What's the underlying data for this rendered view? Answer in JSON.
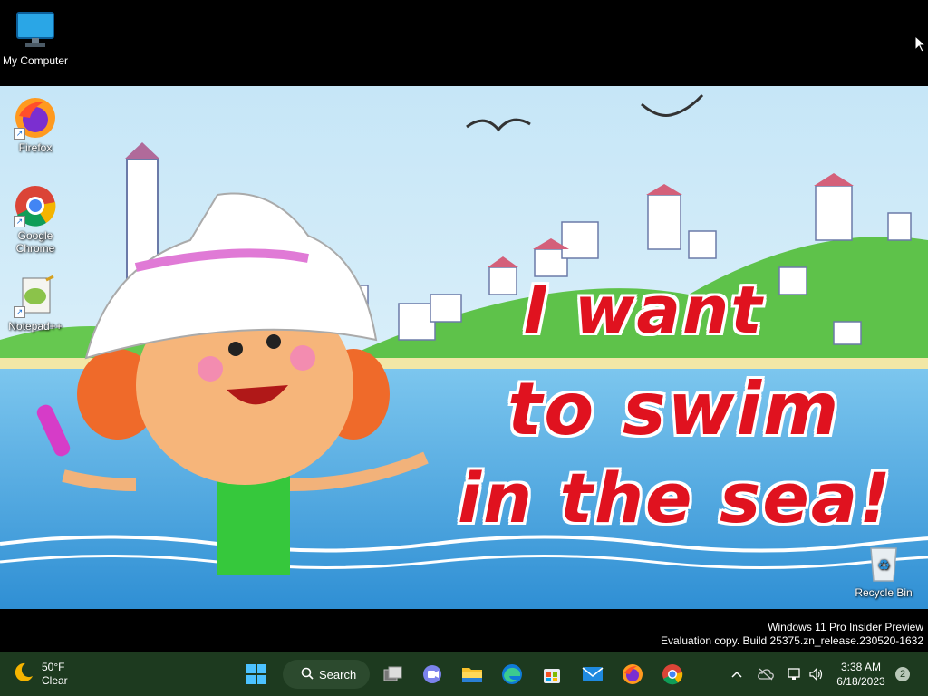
{
  "desktop": {
    "icons": [
      {
        "label": "My Computer"
      },
      {
        "label": "Firefox"
      },
      {
        "label": "Google Chrome"
      },
      {
        "label": "Notepad++"
      },
      {
        "label": "Recycle Bin"
      }
    ],
    "wallpaper_text": [
      "I want",
      "to swim",
      "in the sea!"
    ],
    "watermark": {
      "line1": "Windows 11 Pro Insider Preview",
      "line2": "Evaluation copy. Build 25375.zn_release.230520-1632"
    }
  },
  "taskbar": {
    "weather": {
      "temp": "50°F",
      "condition": "Clear",
      "icon": "moon-icon"
    },
    "search_label": "Search",
    "pinned": [
      "start-icon",
      "search-icon",
      "task-view-icon",
      "teams-chat-icon",
      "file-explorer-icon",
      "edge-icon",
      "store-icon",
      "mail-icon",
      "firefox-icon",
      "chrome-icon"
    ],
    "tray": {
      "time": "3:38 AM",
      "date": "6/18/2023",
      "notifications": "2"
    }
  },
  "colors": {
    "taskbar": "#1d3a1f",
    "wallpaper_sea": "#4aa3e0",
    "wallpaper_text": "#e0121f"
  }
}
